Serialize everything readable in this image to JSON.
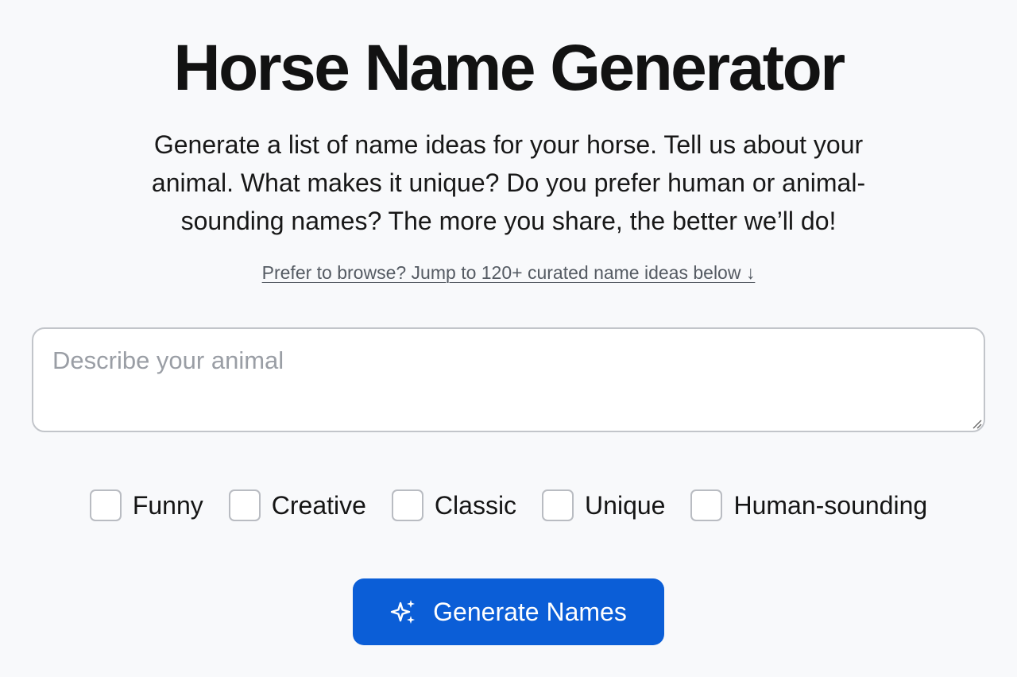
{
  "header": {
    "title": "Horse Name Generator",
    "description": "Generate a list of name ideas for your horse. Tell us about your animal. What makes it unique? Do you prefer human or animal-sounding names? The more you share, the better we’ll do!",
    "browse_link": "Prefer to browse? Jump to 120+ curated name ideas below ↓"
  },
  "form": {
    "description_placeholder": "Describe your animal",
    "description_value": "",
    "options": [
      {
        "label": "Funny",
        "checked": false
      },
      {
        "label": "Creative",
        "checked": false
      },
      {
        "label": "Classic",
        "checked": false
      },
      {
        "label": "Unique",
        "checked": false
      },
      {
        "label": "Human-sounding",
        "checked": false
      }
    ],
    "submit_label": "Generate Names",
    "submit_icon": "sparkle-icon"
  },
  "colors": {
    "background": "#f8f9fb",
    "accent": "#0b5ed7",
    "link": "#555b63",
    "border": "#c2c5ca"
  }
}
